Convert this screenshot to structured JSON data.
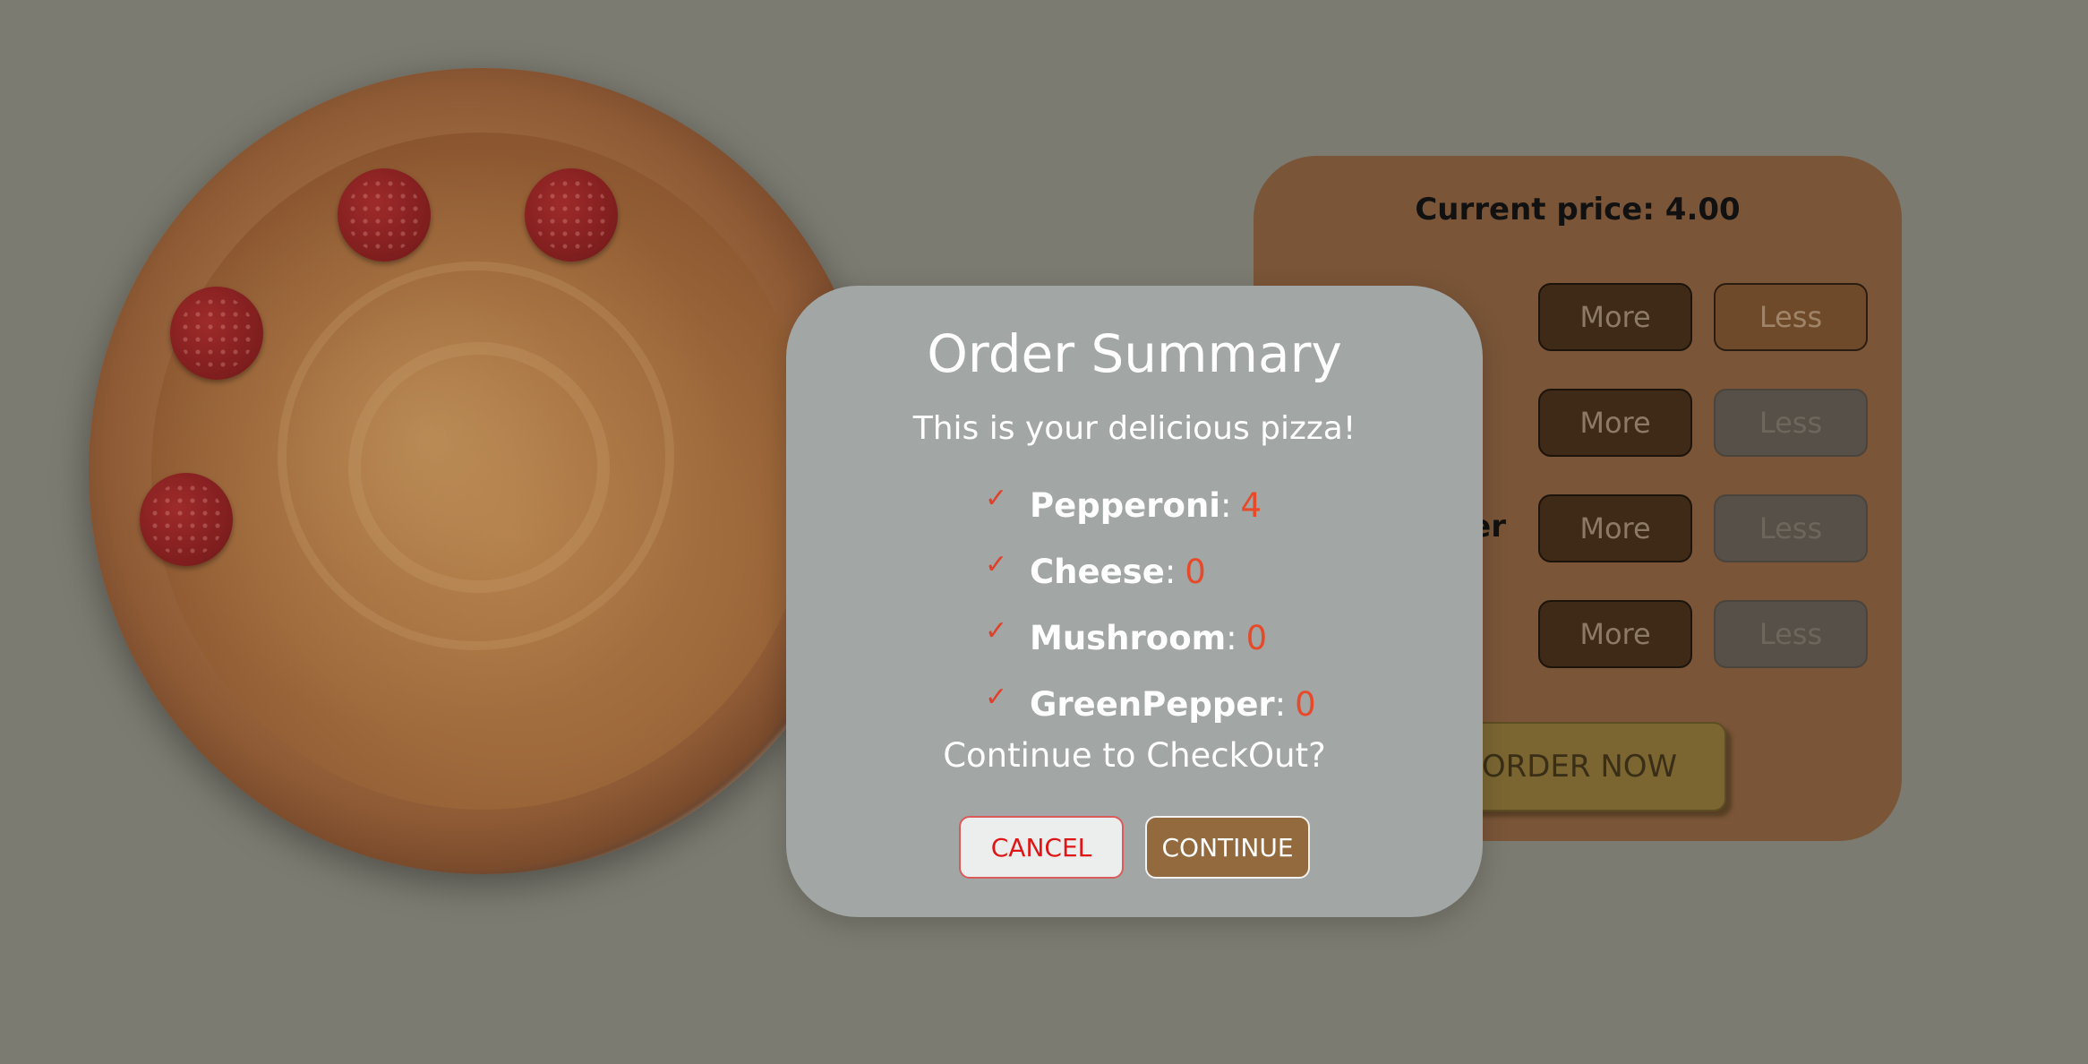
{
  "pizza": {
    "pepperoni_count_shown": 4
  },
  "controls": {
    "price_label": "Current price: 4.00",
    "rows": [
      {
        "label": "",
        "more": "More",
        "less": "Less"
      },
      {
        "label": "",
        "more": "More",
        "less": "Less"
      },
      {
        "label": "er",
        "more": "More",
        "less": "Less"
      },
      {
        "label": "",
        "more": "More",
        "less": "Less"
      }
    ],
    "order_button": "ORDER NOW"
  },
  "modal": {
    "title": "Order Summary",
    "subtitle": "This is your delicious pizza!",
    "check_icon": "✓",
    "items": [
      {
        "name": "Pepperoni",
        "sep": ":",
        "count": "4"
      },
      {
        "name": "Cheese",
        "sep": ":",
        "count": "0"
      },
      {
        "name": "Mushroom",
        "sep": ":",
        "count": "0"
      },
      {
        "name": "GreenPepper",
        "sep": ":",
        "count": "0"
      }
    ],
    "question": "Continue to CheckOut?",
    "cancel_label": "CANCEL",
    "continue_label": "CONTINUE"
  },
  "colors": {
    "backdrop": "#7b7b71",
    "modal_bg": "#a2a6a4",
    "accent_red": "#e74a2a",
    "continue_bg": "#936a3e",
    "controls_bg": "#7a5538"
  }
}
